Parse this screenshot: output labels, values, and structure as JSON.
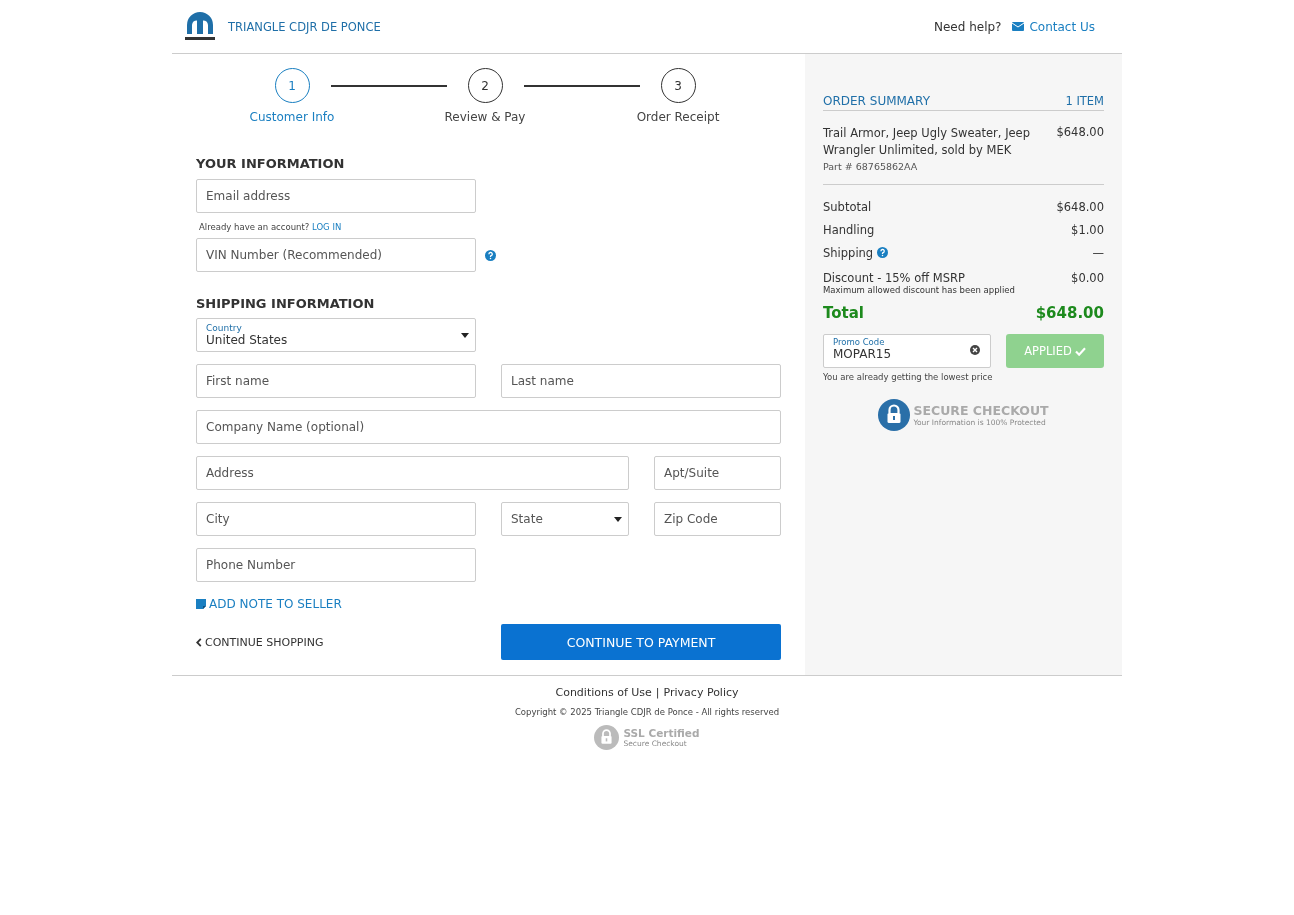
{
  "header": {
    "dealer_name": "TRIANGLE CDJR DE PONCE",
    "help_text": "Need help?",
    "contact_link": "Contact Us"
  },
  "steps": [
    {
      "number": "1",
      "label": "Customer Info",
      "selected": true
    },
    {
      "number": "2",
      "label": "Review & Pay",
      "selected": false
    },
    {
      "number": "3",
      "label": "Order Receipt",
      "selected": false
    }
  ],
  "your_information": {
    "heading": "YOUR INFORMATION",
    "email": {
      "placeholder": "Email address"
    },
    "account_prompt": "Already have an account?",
    "login_link": "LOG IN",
    "vin": {
      "placeholder": "VIN Number (Recommended)"
    }
  },
  "shipping_information": {
    "heading": "SHIPPING INFORMATION",
    "fields": [
      {
        "kind": "select",
        "label": "Country",
        "value": "United States"
      },
      {
        "kind": "text",
        "placeholder": "First name"
      },
      {
        "kind": "text",
        "placeholder": "Last name"
      },
      {
        "kind": "text",
        "placeholder": "Company Name (optional)"
      },
      {
        "kind": "text",
        "placeholder": "Address"
      },
      {
        "kind": "text",
        "placeholder": "Apt/Suite"
      },
      {
        "kind": "text",
        "placeholder": "City"
      },
      {
        "kind": "select",
        "placeholder": "State"
      },
      {
        "kind": "text",
        "placeholder": "Zip Code"
      },
      {
        "kind": "text",
        "placeholder": "Phone Number"
      }
    ]
  },
  "add_note_link": "ADD NOTE TO SELLER",
  "continue_shopping_link": "CONTINUE SHOPPING",
  "continue_button": "CONTINUE TO PAYMENT",
  "order_summary": {
    "heading": "ORDER SUMMARY",
    "item_count": "1 ITEM",
    "items": [
      {
        "name": "Trail Armor, Jeep Ugly Sweater, Jeep Wrangler Unlimited, sold by MEK",
        "part": "Part # 68765862AA",
        "price": "$648.00"
      }
    ],
    "rows": [
      {
        "label": "Subtotal",
        "value": "$648.00",
        "help": false
      },
      {
        "label": "Handling",
        "value": "$1.00",
        "help": false
      },
      {
        "label": "Shipping",
        "value": "—",
        "help": true
      }
    ],
    "discount": {
      "label": "Discount - 15% off MSRP",
      "note": "Maximum allowed discount has been applied",
      "value": "$0.00"
    },
    "total": {
      "label": "Total",
      "value": "$648.00"
    },
    "promo": {
      "label": "Promo Code",
      "value": "MOPAR15",
      "button": "APPLIED",
      "applied": true,
      "note": "You are already getting the lowest price"
    },
    "secure_badge": {
      "title": "SECURE CHECKOUT",
      "subtitle": "Your Information is 100% Protected"
    }
  },
  "footer": {
    "links": [
      "Conditions of Use",
      "Privacy Policy"
    ],
    "separator": "|",
    "copyright": "Copyright © 2025 Triangle CDJR de Ponce - All rights reserved",
    "ssl_badge": {
      "title": "SSL Certified",
      "subtitle": "Secure Checkout"
    }
  }
}
